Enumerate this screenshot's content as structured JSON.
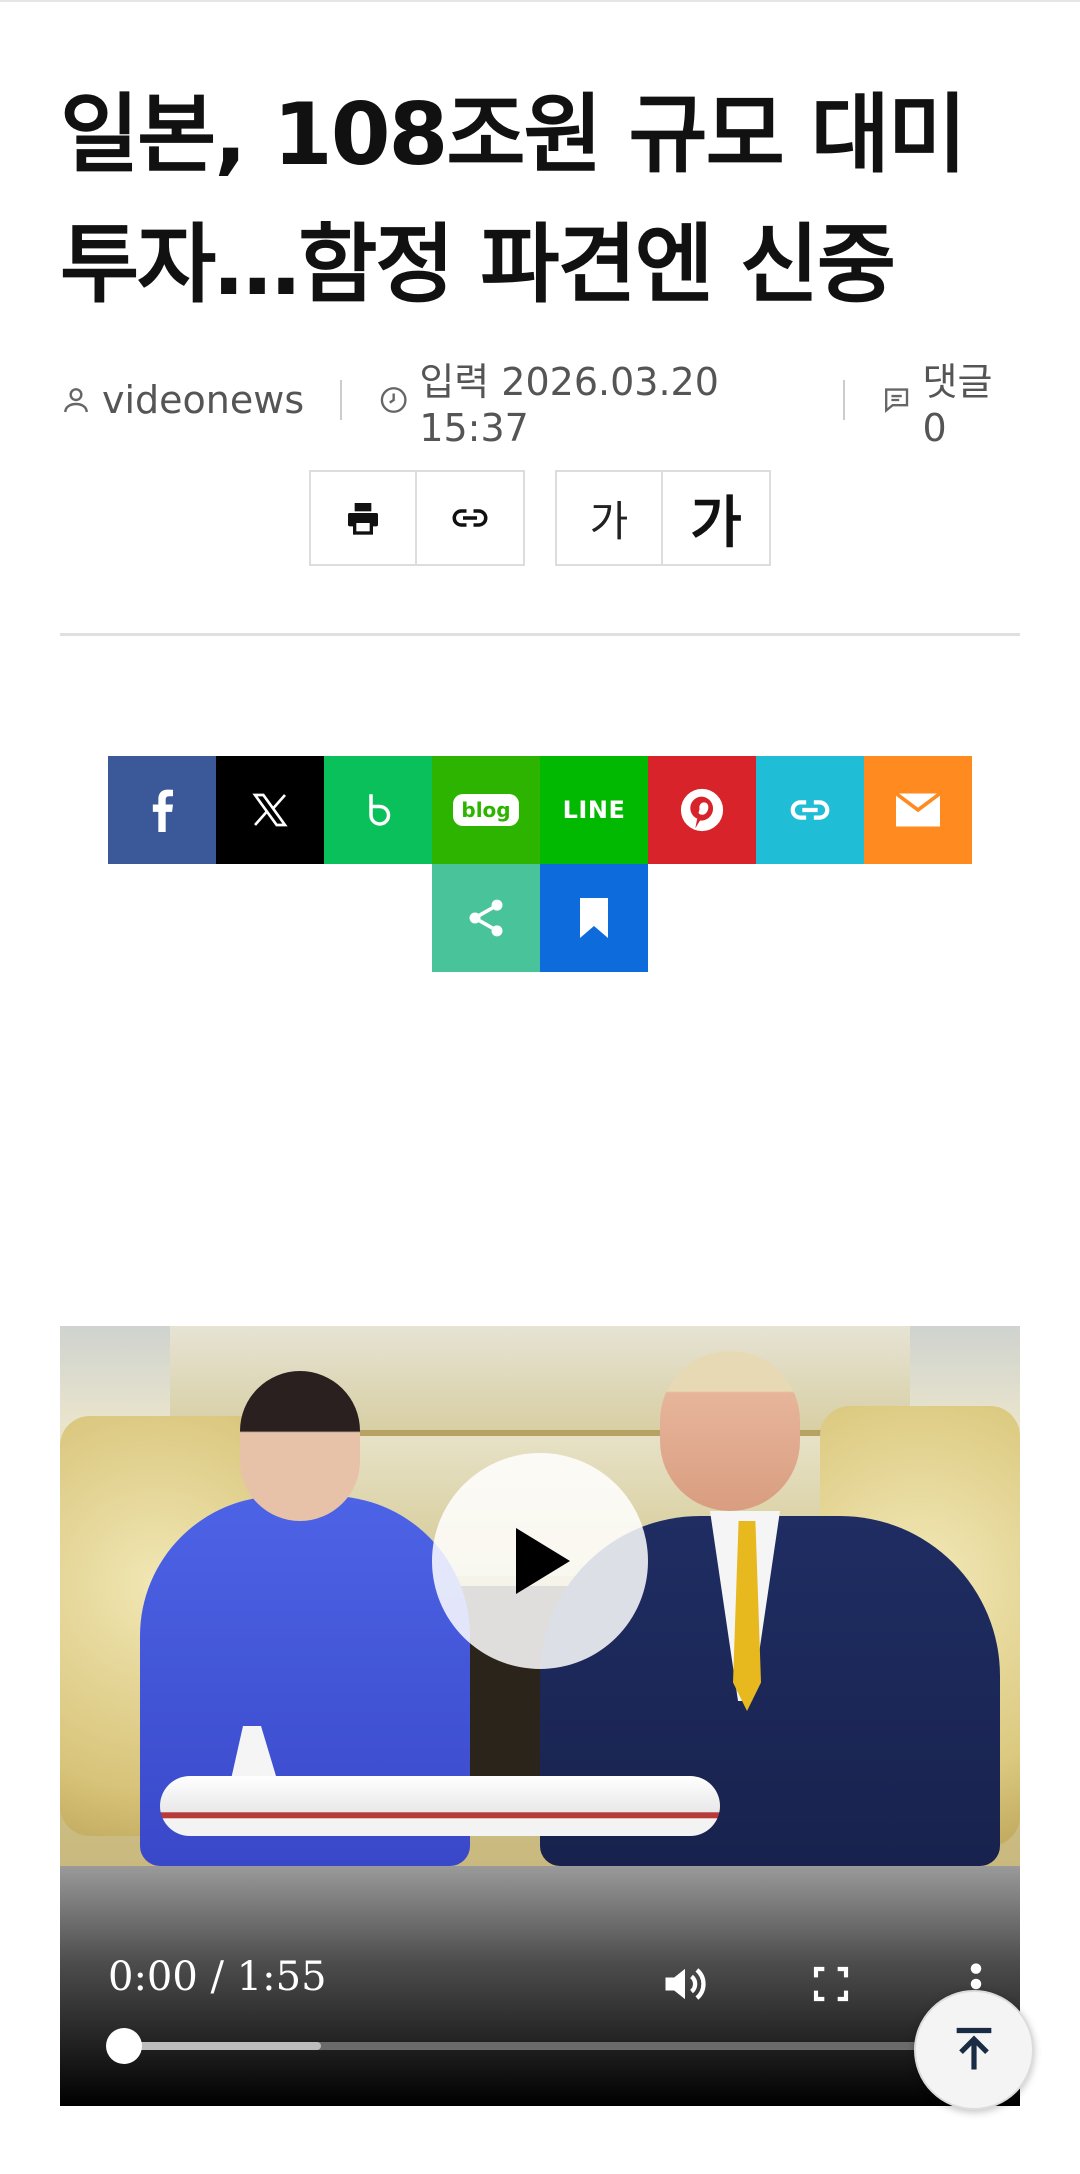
{
  "article": {
    "headline_line1": "일본, 108조원 규모 대미",
    "headline_line2": "투자…함정 파견엔 신중",
    "author": "videonews",
    "published": "입력 2026.03.20 15:37",
    "comments": "댓글 0"
  },
  "tools": {
    "print_icon": "print-icon",
    "link_icon": "link-icon",
    "font_small_label": "가",
    "font_large_label": "가"
  },
  "share": {
    "items": [
      "facebook",
      "x",
      "band",
      "blog",
      "LINE",
      "pinterest",
      "link",
      "email",
      "share",
      "bookmark"
    ],
    "blog_label": "blog",
    "line_label": "LINE",
    "colors": {
      "facebook": "#3b5998",
      "x": "#000000",
      "band": "#0ac05a",
      "blog": "#2db400",
      "line": "#00b900",
      "pinterest": "#d8232a",
      "link": "#1fbed6",
      "email": "#ff8a1f",
      "share": "#48c39a",
      "bookmark": "#0d6bdc"
    }
  },
  "video": {
    "time_display": "0:00 / 1:55",
    "current": "0:00",
    "duration": "1:55",
    "progress": 0,
    "buffered": 0.24
  },
  "scroll_top_icon": "arrow-up-to-top-icon"
}
